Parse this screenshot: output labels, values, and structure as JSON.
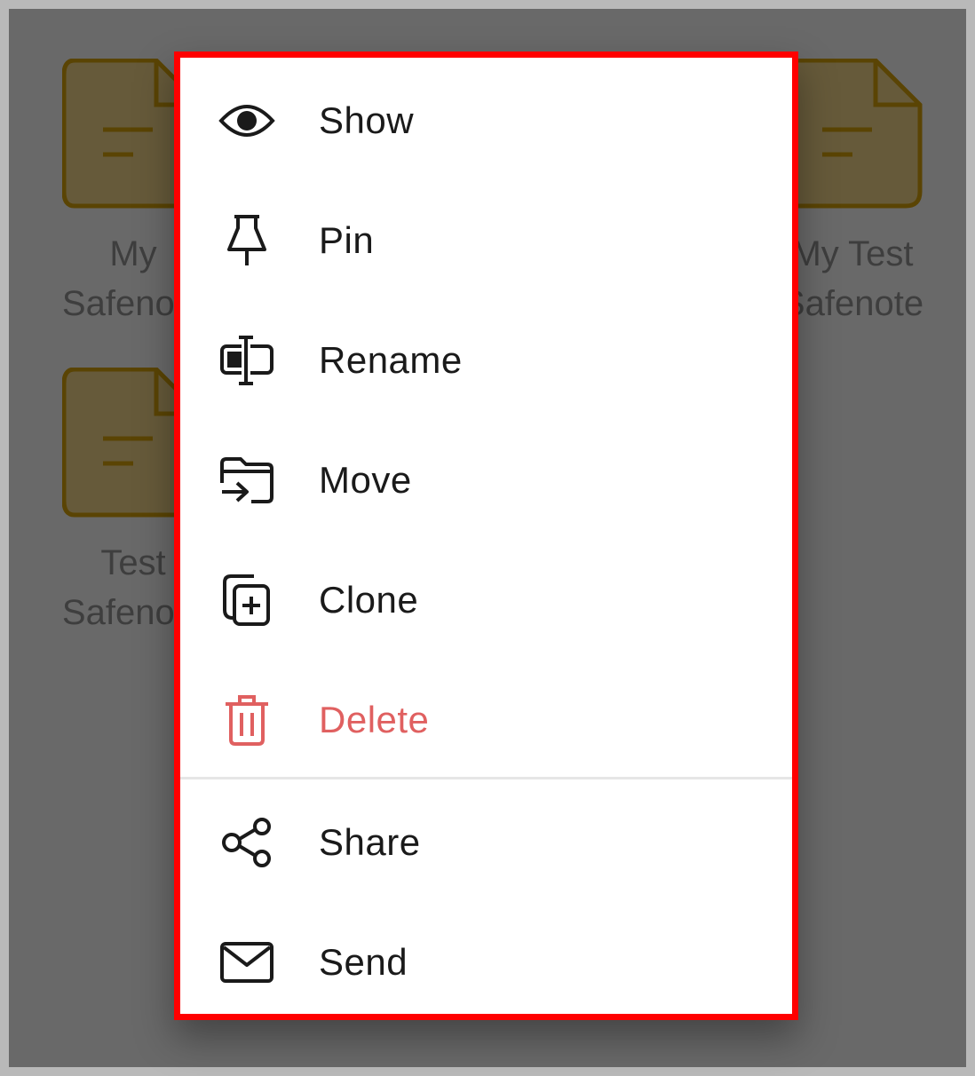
{
  "background_files": [
    {
      "label": "My\nSafenote"
    },
    {
      "label": "My Test\nSafenote"
    },
    {
      "label": "Test\nSafenote"
    }
  ],
  "menu": {
    "items": [
      {
        "label": "Show",
        "icon": "eye-icon"
      },
      {
        "label": "Pin",
        "icon": "pin-icon"
      },
      {
        "label": "Rename",
        "icon": "rename-icon"
      },
      {
        "label": "Move",
        "icon": "move-folder-icon"
      },
      {
        "label": "Clone",
        "icon": "clone-icon"
      },
      {
        "label": "Delete",
        "icon": "trash-icon"
      },
      {
        "label": "Share",
        "icon": "share-icon"
      },
      {
        "label": "Send",
        "icon": "envelope-icon"
      }
    ]
  },
  "colors": {
    "overlay": "#696969",
    "menu_border": "#ff0000",
    "menu_background": "#ffffff",
    "delete": "#e06060",
    "file_fill": "#665a3a",
    "file_stroke": "#5a4404"
  }
}
